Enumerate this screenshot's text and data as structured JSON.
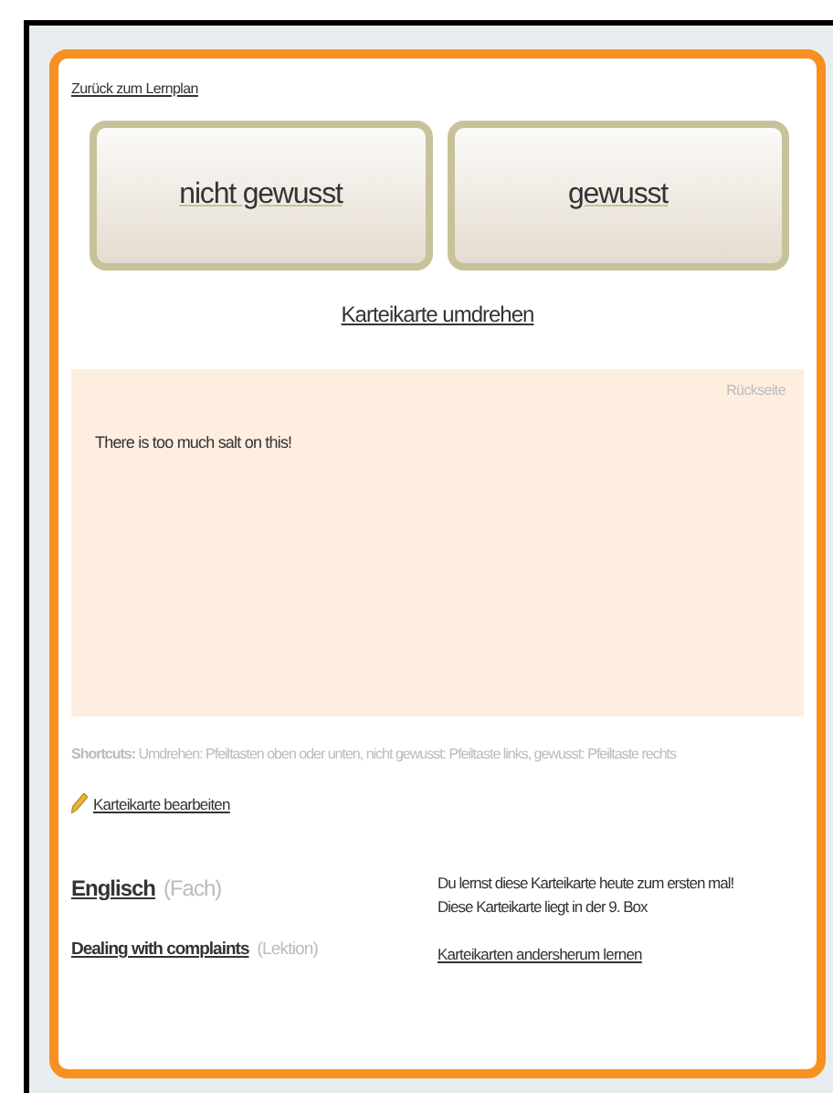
{
  "back_link": "Zurück zum Lernplan",
  "answer_buttons": [
    {
      "label": "nicht gewusst"
    },
    {
      "label": "gewusst"
    }
  ],
  "flip_link": "Karteikarte umdrehen",
  "card": {
    "side": "Rückseite",
    "text": "There is too much salt on this!"
  },
  "shortcuts": "**Shortcuts:** Umdrehen: Pfeiltasten oben oder unten, nicht gewusst: Pfeiltaste links, gewusst: Pfeiltaste rechts",
  "edit_link": "Karteikarte bearbeiten",
  "subject": {
    "name": "Englisch",
    "type": "(Fach)"
  },
  "lesson": {
    "name": "Dealing with complaints",
    "type": "(Lektion)"
  },
  "info": [
    "Du lernst diese Karteikarte heute zum ersten mal!",
    "Diese Karteikarte liegt in der 9. Box"
  ],
  "reverse_link": "Karteikarten andersherum lernen"
}
